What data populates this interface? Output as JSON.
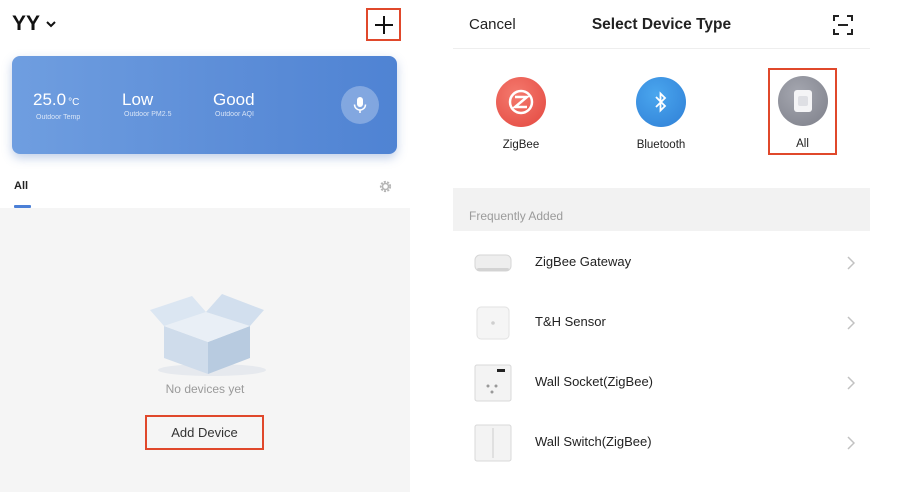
{
  "home": {
    "name": "YY",
    "weather": {
      "temperature": {
        "value": "25.0",
        "unit": "°C",
        "label": "Outdoor Temp"
      },
      "pm25": {
        "value": "Low",
        "label": "Outdoor PM2.5"
      },
      "aqi": {
        "value": "Good",
        "label": "Outdoor AQI"
      }
    },
    "room_tab": "All",
    "empty_message": "No devices yet",
    "add_device_label": "Add Device"
  },
  "select_type": {
    "cancel_label": "Cancel",
    "title": "Select Device Type",
    "types": [
      {
        "label": "ZigBee",
        "icon": "zigbee-icon"
      },
      {
        "label": "Bluetooth",
        "icon": "bluetooth-icon"
      },
      {
        "label": "All",
        "icon": "all-devices-icon"
      }
    ],
    "section_header": "Frequently Added",
    "devices": [
      {
        "name": "ZigBee Gateway",
        "icon": "gateway-icon"
      },
      {
        "name": "T&H Sensor",
        "icon": "sensor-icon"
      },
      {
        "name": "Wall Socket(ZigBee)",
        "icon": "socket-icon"
      },
      {
        "name": "Wall Switch(ZigBee)",
        "icon": "switch-icon"
      }
    ]
  },
  "colors": {
    "highlight": "#e0482b",
    "accent": "#4b7fd6",
    "zigbee": "#e3473f",
    "bluetooth": "#2f7fd6"
  }
}
